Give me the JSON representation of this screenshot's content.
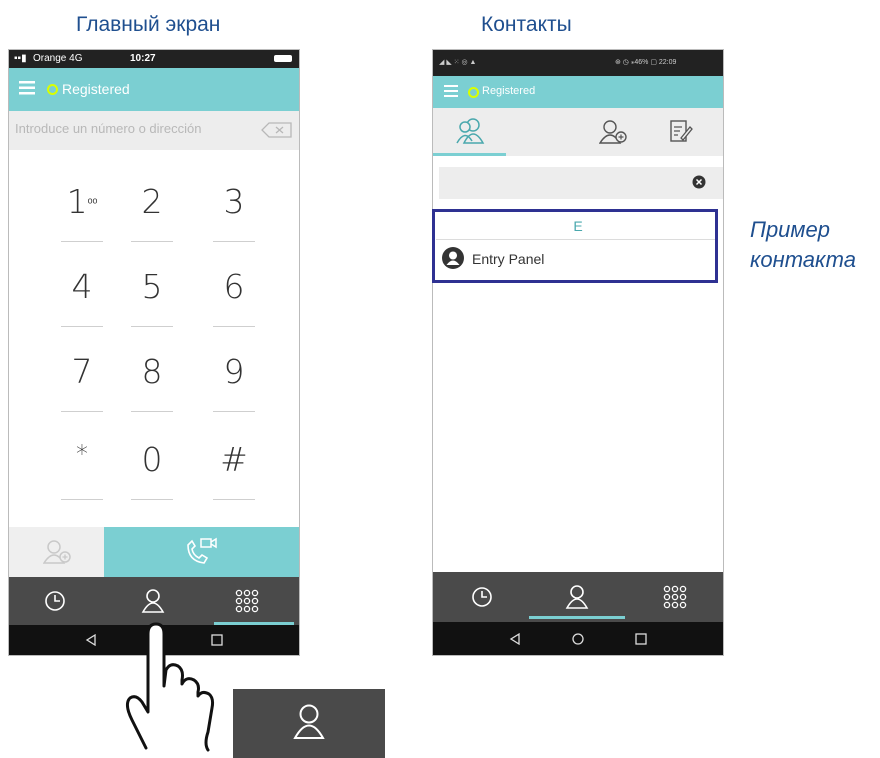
{
  "captions": {
    "home_title": "Главный экран",
    "contacts_title": "Контакты",
    "annotation_line1": "Пример",
    "annotation_line2": "контакта"
  },
  "home_screen": {
    "status_bar": {
      "carrier": "Orange 4G",
      "time": "10:27"
    },
    "app_bar": {
      "status": "Registered"
    },
    "number_input": {
      "placeholder": "Introduce un número o dirección"
    },
    "keypad": [
      {
        "digit": "1",
        "sub": "ᵒᵒ"
      },
      {
        "digit": "2",
        "sub": ""
      },
      {
        "digit": "3",
        "sub": ""
      },
      {
        "digit": "4",
        "sub": ""
      },
      {
        "digit": "5",
        "sub": ""
      },
      {
        "digit": "6",
        "sub": ""
      },
      {
        "digit": "7",
        "sub": ""
      },
      {
        "digit": "8",
        "sub": ""
      },
      {
        "digit": "9",
        "sub": ""
      },
      {
        "digit": "*",
        "sub": ""
      },
      {
        "digit": "0",
        "sub": "+"
      },
      {
        "digit": "#",
        "sub": ""
      }
    ],
    "bottom_nav": [
      "history-icon",
      "contacts-icon",
      "dialpad-icon"
    ]
  },
  "contacts_screen": {
    "status_bar": {
      "right": "⊛ ◷ ⁎46% ▢ 22:09"
    },
    "app_bar": {
      "status": "Registered"
    },
    "tabs": [
      "contacts-icon",
      "add-contact-icon",
      "edit-list-icon"
    ],
    "section_letter": "E",
    "contacts": [
      {
        "name": "Entry Panel"
      }
    ],
    "bottom_nav": [
      "history-icon",
      "contacts-icon",
      "dialpad-icon"
    ]
  },
  "colors": {
    "accent_teal": "#7bcfd2",
    "nav_dark": "#4a4a4a",
    "highlight_border": "#2e3192",
    "caption_blue": "#1f4f8f",
    "registered_dot": "#d9ff00"
  }
}
